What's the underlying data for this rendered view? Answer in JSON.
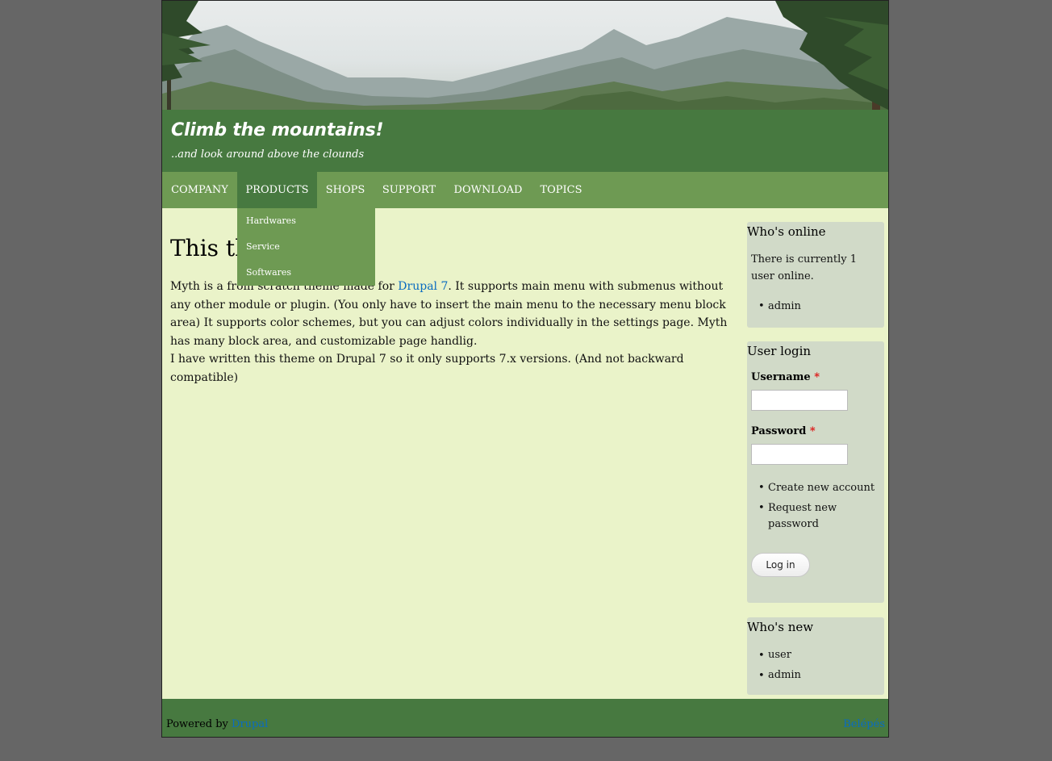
{
  "header": {
    "site_name": "Climb the mountains!",
    "slogan": "..and look around above the clounds"
  },
  "nav": {
    "items": [
      {
        "label": "COMPANY"
      },
      {
        "label": "PRODUCTS"
      },
      {
        "label": "SHOPS"
      },
      {
        "label": "SUPPORT"
      },
      {
        "label": "DOWNLOAD"
      },
      {
        "label": "TOPICS"
      }
    ],
    "active": "PRODUCTS",
    "submenu": [
      {
        "label": "Hardwares"
      },
      {
        "label": "Service"
      },
      {
        "label": "Softwares"
      }
    ]
  },
  "main": {
    "title": "This th",
    "p1_before": "Myth is a from scratch theme made for ",
    "p1_link": "Drupal 7",
    "p1_after": ". It supports main menu with submenus without any other module or plugin. (You only have to insert the main menu to the necessary menu block area) It supports color schemes, but you can adjust colors individually in the settings page. Myth has many block area, and customizable page handlig.",
    "p2": "I have written this theme on Drupal 7 so it only supports 7.x versions. (And not backward compatible)"
  },
  "sidebar": {
    "whos_online": {
      "title": "Who's online",
      "text": "There is currently 1 user online.",
      "users": [
        "admin"
      ]
    },
    "user_login": {
      "title": "User login",
      "username_label": "Username",
      "password_label": "Password",
      "required_mark": "*",
      "username_value": "",
      "password_value": "",
      "links": [
        "Create new account",
        "Request new password"
      ],
      "button": "Log in"
    },
    "whos_new": {
      "title": "Who's new",
      "users": [
        "user",
        "admin"
      ]
    }
  },
  "footer": {
    "powered_by": "Powered by",
    "powered_link": "Drupal",
    "right_link": "Belépés"
  },
  "colors": {
    "header_green": "#477940",
    "nav_green": "#6e9a53",
    "content_bg": "#eaf3c9",
    "block_bg": "#d1dac8",
    "link_blue": "#0a6cc0"
  }
}
